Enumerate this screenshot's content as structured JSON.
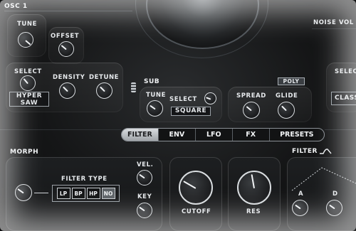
{
  "osc": {
    "title": "OSC 1",
    "tune_label": "TUNE",
    "offset_label": "OFFSET",
    "select_label": "SELECT",
    "density_label": "DENSITY",
    "detune_label": "DETUNE",
    "wave_line1": "HYPER",
    "wave_line2": "SAW"
  },
  "noise": {
    "label": "NOISE VOL"
  },
  "sub": {
    "title": "SUB",
    "tune_label": "TUNE",
    "select_label": "SELECT",
    "wave_value": "SQUARE",
    "spread_label": "SPREAD",
    "glide_label": "GLIDE",
    "poly_label": "POLY"
  },
  "right": {
    "select_label": "SELEC",
    "value": "CLASS"
  },
  "tabs": [
    "FILTER",
    "ENV",
    "LFO",
    "FX",
    "PRESETS"
  ],
  "active_tab": "FILTER",
  "morph": {
    "title": "MORPH",
    "filter_type_label": "FILTER TYPE",
    "types": [
      "LP",
      "BP",
      "HP",
      "NO"
    ],
    "selected_type": "NO",
    "vel_label": "VEL.",
    "key_label": "KEY"
  },
  "cutoff": {
    "label": "CUTOFF"
  },
  "res": {
    "label": "RES"
  },
  "filter_env": {
    "title": "FILTER",
    "a_label": "A",
    "d_label": "D"
  },
  "colors": {
    "accent": "#e9ecef",
    "active_tab": "#c9cdd1",
    "background": "#151617"
  }
}
